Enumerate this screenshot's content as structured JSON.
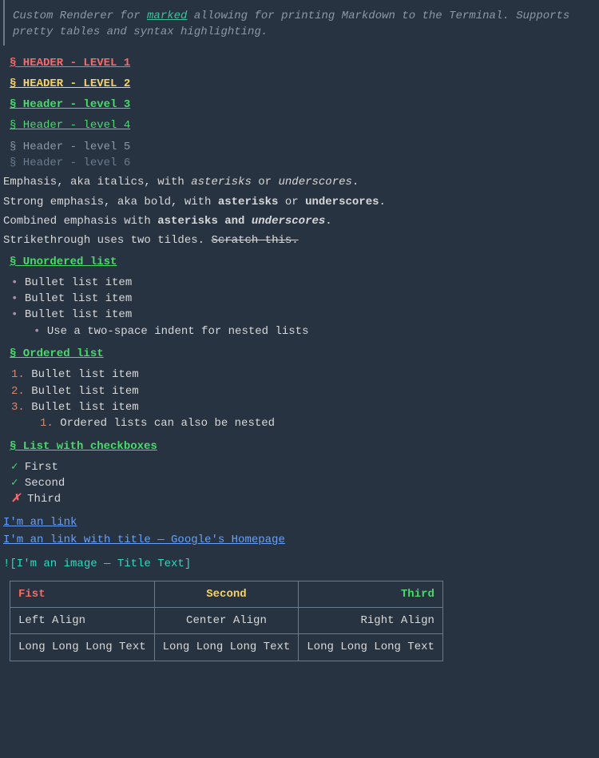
{
  "intro": {
    "pre": "Custom Renderer for ",
    "link": "marked",
    "post": " allowing for printing Markdown to the Terminal. Supports pretty tables and syntax highlighting."
  },
  "headers": {
    "h1": "§ HEADER - LEVEL 1",
    "h2": "§ HEADER - LEVEL 2",
    "h3": "§ Header - level 3",
    "h4": "§ Header - level 4",
    "h5": "§ Header - level 5",
    "h6": "§ Header - level 6"
  },
  "emphasis": {
    "line1_a": "Emphasis, aka italics, with ",
    "line1_b": "asterisks",
    "line1_c": " or ",
    "line1_d": "underscores",
    "line1_e": ".",
    "line2_a": "Strong emphasis, aka bold, with ",
    "line2_b": "asterisks",
    "line2_c": " or ",
    "line2_d": "underscores",
    "line2_e": ".",
    "line3_a": "Combined emphasis with ",
    "line3_b": "asterisks and ",
    "line3_c": "underscores",
    "line3_d": ".",
    "line4_a": "Strikethrough uses two tildes. ",
    "line4_b": "Scratch this."
  },
  "unordered": {
    "title": "§ Unordered list",
    "items": [
      "Bullet list item",
      "Bullet list item",
      "Bullet list item"
    ],
    "nested": "Use a two-space indent for nested lists"
  },
  "ordered": {
    "title": "§ Ordered list",
    "items": [
      "Bullet list item",
      "Bullet list item",
      "Bullet list item"
    ],
    "nested": "Ordered lists can also be nested"
  },
  "checkboxes": {
    "title": "§ List with checkboxes",
    "items": [
      {
        "mark": "✓",
        "ok": true,
        "text": "First"
      },
      {
        "mark": "✓",
        "ok": true,
        "text": "Second"
      },
      {
        "mark": "✗",
        "ok": false,
        "text": "Third"
      }
    ]
  },
  "links": {
    "l1": "I'm an link",
    "l2": "I'm an link with title — Google's Homepage"
  },
  "image": "![I'm an image —  Title Text]",
  "table": {
    "head": [
      "Fist",
      "Second",
      "Third"
    ],
    "rows": [
      [
        "Left Align",
        "Center Align",
        "Right Align"
      ],
      [
        "Long Long Long Text",
        "Long Long Long Text",
        "Long Long Long Text"
      ]
    ]
  }
}
